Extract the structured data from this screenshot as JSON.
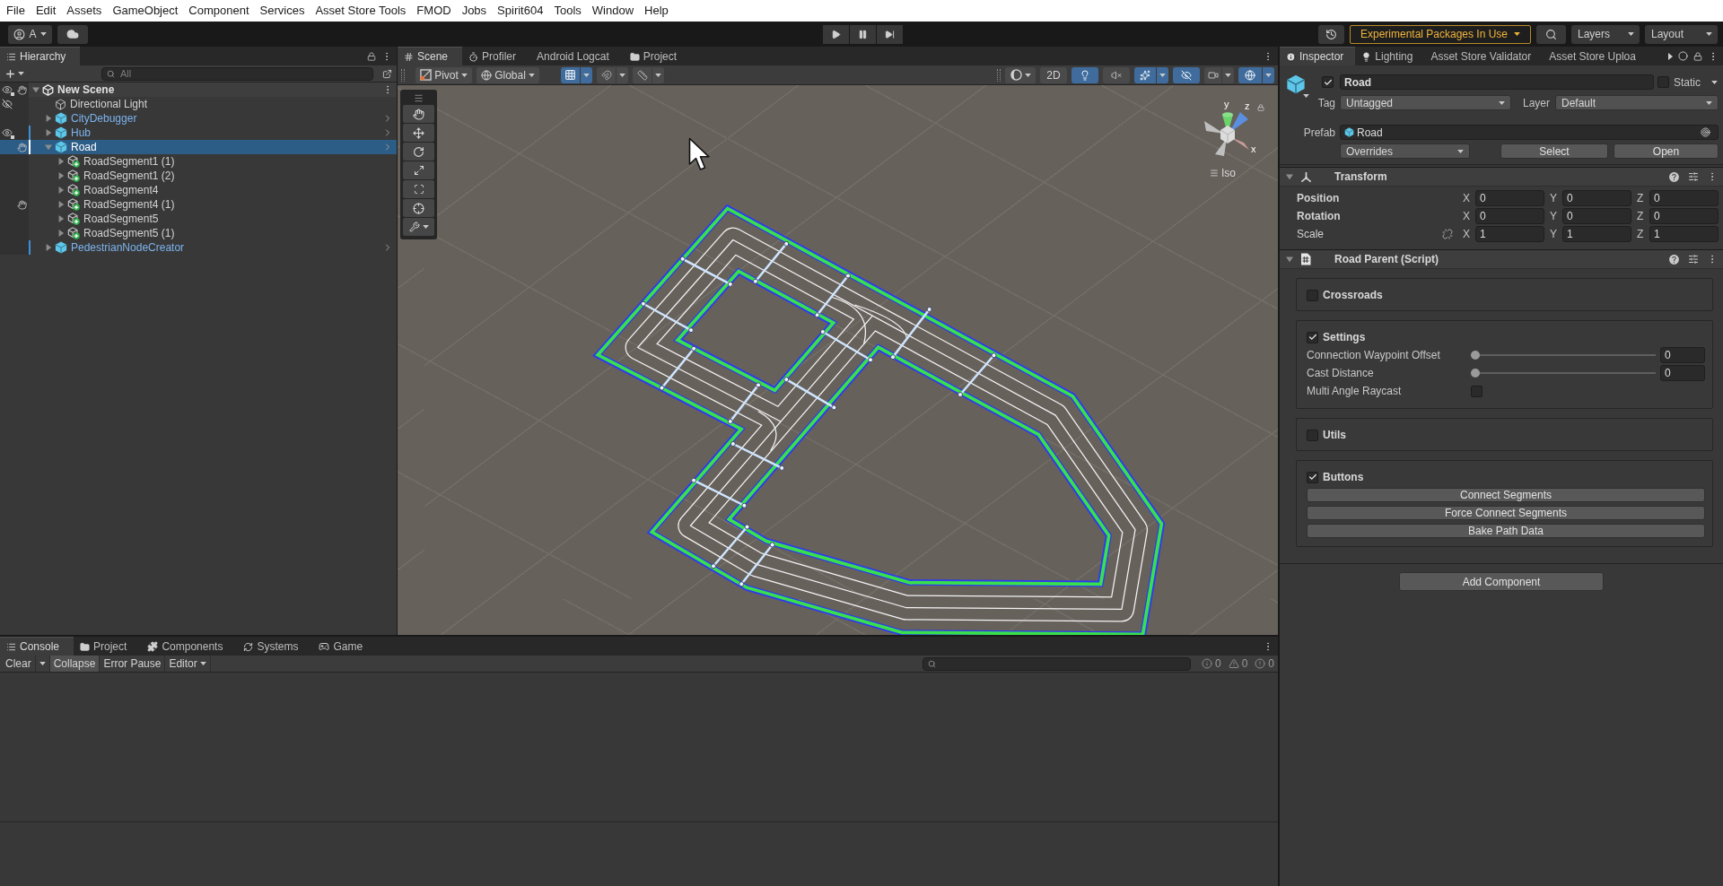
{
  "menu_bar": [
    "File",
    "Edit",
    "Assets",
    "GameObject",
    "Component",
    "Services",
    "Asset Store Tools",
    "FMOD",
    "Jobs",
    "Spirit604",
    "Tools",
    "Window",
    "Help"
  ],
  "toolbar": {
    "account": "A",
    "packages_notice": "Experimental Packages In Use",
    "layers": "Layers",
    "layout": "Layout"
  },
  "hierarchy": {
    "tab": "Hierarchy",
    "search": {
      "placeholder": "All"
    },
    "scene": {
      "label": "New Scene",
      "expanded": true,
      "hidden_children": true,
      "unpickable": true,
      "children": [
        {
          "label": "Directional Light",
          "kind": "object",
          "expandable": false,
          "selected": false,
          "overridden": false,
          "hidden": true,
          "hidden_children": false,
          "unpickable": false
        },
        {
          "label": "CityDebugger",
          "kind": "prefab",
          "expandable": true,
          "expanded": false,
          "selected": false,
          "overridden": false,
          "hidden": false,
          "hidden_children": false,
          "unpickable": false
        },
        {
          "label": "Hub",
          "kind": "prefab",
          "expandable": true,
          "expanded": false,
          "selected": false,
          "overridden": true,
          "hidden": false,
          "hidden_children": true,
          "unpickable": false
        },
        {
          "label": "Road",
          "kind": "prefab",
          "expandable": true,
          "expanded": true,
          "selected": true,
          "overridden": true,
          "hidden": false,
          "hidden_children": false,
          "unpickable": true,
          "children": [
            {
              "label": "RoadSegment1 (1)",
              "kind": "added",
              "expandable": true,
              "expanded": false,
              "selected": false,
              "overridden": false,
              "hidden": false,
              "hidden_children": false,
              "unpickable": false
            },
            {
              "label": "RoadSegment1 (2)",
              "kind": "added",
              "expandable": true,
              "expanded": false,
              "selected": false,
              "overridden": false,
              "hidden": false,
              "hidden_children": false,
              "unpickable": false
            },
            {
              "label": "RoadSegment4",
              "kind": "added",
              "expandable": true,
              "expanded": false,
              "selected": false,
              "overridden": false,
              "hidden": false,
              "hidden_children": false,
              "unpickable": false
            },
            {
              "label": "RoadSegment4 (1)",
              "kind": "added",
              "expandable": true,
              "expanded": false,
              "selected": false,
              "overridden": false,
              "hidden": false,
              "hidden_children": false,
              "unpickable": true
            },
            {
              "label": "RoadSegment5",
              "kind": "added",
              "expandable": true,
              "expanded": false,
              "selected": false,
              "overridden": false,
              "hidden": false,
              "hidden_children": false,
              "unpickable": false
            },
            {
              "label": "RoadSegment5 (1)",
              "kind": "added",
              "expandable": true,
              "expanded": false,
              "selected": false,
              "overridden": false,
              "hidden": false,
              "hidden_children": false,
              "unpickable": false
            }
          ]
        },
        {
          "label": "PedestrianNodeCreator",
          "kind": "prefab",
          "expandable": true,
          "expanded": false,
          "selected": false,
          "overridden": true,
          "hidden": false,
          "hidden_children": false,
          "unpickable": false
        }
      ]
    }
  },
  "scene_view": {
    "tabs": [
      {
        "label": "Scene",
        "kind": "scene",
        "selected": true
      },
      {
        "label": "Profiler",
        "kind": "profiler",
        "selected": false
      },
      {
        "label": "Android Logcat",
        "kind": "logcat",
        "selected": false
      },
      {
        "label": "Project",
        "kind": "project",
        "selected": false
      }
    ],
    "toolbar": {
      "pivot": "Pivot",
      "space": "Global",
      "snap_tools": [
        {
          "kind": "grid",
          "on": true
        },
        {
          "kind": "snap",
          "on": false
        },
        {
          "kind": "increment",
          "on": false
        }
      ],
      "view_options": [
        {
          "kind": "shading"
        },
        {
          "kind": "mode",
          "label": "2D",
          "on": false
        },
        {
          "kind": "lighting",
          "on": true
        },
        {
          "kind": "audio",
          "on": false
        },
        {
          "kind": "effects",
          "on": true
        },
        {
          "kind": "hidden",
          "on": true
        },
        {
          "kind": "camera",
          "on": false
        },
        {
          "kind": "gizmos",
          "on": true
        }
      ]
    },
    "gizmo": {
      "axes": [
        "y",
        "z",
        "x"
      ],
      "projection": "Iso"
    }
  },
  "inspector": {
    "tabs": [
      {
        "label": "Inspector",
        "kind": "inspector",
        "selected": true
      },
      {
        "label": "Lighting",
        "kind": "lighting",
        "selected": false
      },
      {
        "label": "Asset Store Validator",
        "kind": "validator",
        "selected": false
      },
      {
        "label": "Asset Store Uploa",
        "kind": "uploader",
        "selected": false
      }
    ],
    "object": {
      "active": true,
      "name": "Road",
      "static": false,
      "static_label": "Static",
      "tag_label": "Tag",
      "tag": "Untagged",
      "layer_label": "Layer",
      "layer": "Default"
    },
    "prefab": {
      "label": "Prefab",
      "asset": "Road",
      "overrides": "Overrides",
      "actions": [
        "Select",
        "Open"
      ]
    },
    "components": [
      {
        "kind": "transform",
        "title": "Transform",
        "expanded": true,
        "rows": [
          {
            "kind": "position",
            "label": "Position",
            "overridden": true,
            "values": [
              {
                "axis": "X",
                "value": "0"
              },
              {
                "axis": "Y",
                "value": "0"
              },
              {
                "axis": "Z",
                "value": "0"
              }
            ]
          },
          {
            "kind": "rotation",
            "label": "Rotation",
            "overridden": true,
            "values": [
              {
                "axis": "X",
                "value": "0"
              },
              {
                "axis": "Y",
                "value": "0"
              },
              {
                "axis": "Z",
                "value": "0"
              }
            ]
          },
          {
            "kind": "scale",
            "label": "Scale",
            "overridden": false,
            "constrained": false,
            "values": [
              {
                "axis": "X",
                "value": "1"
              },
              {
                "axis": "Y",
                "value": "1"
              },
              {
                "axis": "Z",
                "value": "1"
              }
            ]
          }
        ]
      },
      {
        "kind": "script",
        "title": "Road Parent (Script)",
        "expanded": true,
        "groups": [
          {
            "title": "Crossroads",
            "checked": false
          },
          {
            "title": "Settings",
            "checked": true,
            "fields": [
              {
                "kind": "slider",
                "label": "Connection Waypoint Offset",
                "level": 0,
                "value": "0"
              },
              {
                "kind": "slider",
                "label": "Cast Distance",
                "level": 0,
                "value": "0"
              },
              {
                "kind": "toggle",
                "label": "Multi Angle Raycast",
                "checked": false
              }
            ]
          },
          {
            "title": "Utils",
            "checked": false
          },
          {
            "title": "Buttons",
            "checked": true,
            "buttons": [
              "Connect Segments",
              "Force Connect Segments",
              "Bake Path Data"
            ]
          }
        ]
      }
    ],
    "add_component": "Add Component"
  },
  "console": {
    "tabs": [
      {
        "label": "Console",
        "kind": "console",
        "selected": true
      },
      {
        "label": "Project",
        "kind": "project",
        "selected": false
      },
      {
        "label": "Components",
        "kind": "components",
        "selected": false
      },
      {
        "label": "Systems",
        "kind": "systems",
        "selected": false
      },
      {
        "label": "Game",
        "kind": "game",
        "selected": false
      }
    ],
    "toolbar": {
      "clear": "Clear",
      "collapse": {
        "label": "Collapse",
        "on": true
      },
      "error_pause": {
        "label": "Error Pause",
        "on": false
      },
      "editor": "Editor"
    },
    "counts": [
      {
        "kind": "info",
        "value": "0"
      },
      {
        "kind": "warning",
        "value": "0"
      },
      {
        "kind": "error",
        "value": "0"
      }
    ]
  }
}
